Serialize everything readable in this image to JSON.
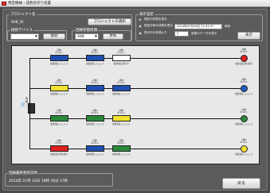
{
  "window": {
    "title": "特定機械・成熟見守り装置"
  },
  "project": {
    "group_label": "プロジェクト名",
    "name": "DAB_50",
    "select_button": "プロジェクトの選択"
  },
  "connection": {
    "group_label": "接続デバイス",
    "device_value": "",
    "connect_button": "接続"
  },
  "interval": {
    "group_label": "回線状態周期",
    "value": "30秒",
    "change_button": "更新"
  },
  "display": {
    "group_label": "表示設定",
    "options": [
      {
        "label": "現在の状態を表示",
        "selected": true
      },
      {
        "label": "指定日時の状態を表示",
        "selected": false
      },
      {
        "label": "表示中の状態より",
        "selected": false
      }
    ],
    "datetime_value": "2014年07月16日 11:31:47",
    "datetime_suffix": "時刻",
    "offset_value": "0",
    "offset_suffix": "前後のデータを表示",
    "show_button": "表示"
  },
  "network": {
    "gateway_label": "親機",
    "rows": [
      {
        "nodes": [
          {
            "head": "子機1\nID:ID:1",
            "foot": "電波強度:ｙｙｙ_0",
            "color": "#1f4fb0"
          },
          {
            "head": "子機2\nID:ID:2",
            "foot": "電波強度:ｙｙｙ_0",
            "color": "#1f4fb0"
          },
          {
            "head": "子機3\nID:ID:3",
            "foot": "電波強度:警告中",
            "color": "#ffffff"
          }
        ],
        "end": {
          "head": "子機4\nID:ID:4",
          "foot": "電波強度:通信異常",
          "color": "#e02020"
        }
      },
      {
        "nodes": [
          {
            "head": "子機1\nID:ID:1",
            "foot": "電波強度:ｙｙｙ_0",
            "color": "#f0e030"
          },
          {
            "head": "子機2\nID:ID:2",
            "foot": "電波強度:ｙｙｙ_0",
            "color": "#1f4fb0"
          },
          {
            "head": "子機3\nID:ID:3",
            "foot": "電波強度:ｙｙｙ_0",
            "color": "#1f4fb0"
          }
        ],
        "end": {
          "head": "子機4\nID:ID:4",
          "foot": "電波強度:ｙｙｙ_0",
          "color": "#2060c0"
        }
      },
      {
        "nodes": [
          {
            "head": "子機1\nID:ID:1",
            "foot": "電波強度:ｙｙｙ_0",
            "color": "#2a8a3a"
          },
          {
            "head": "子機2\nID:ID:2",
            "foot": "電波強度:ｙｙｙ_0",
            "color": "#2a8a3a"
          },
          {
            "head": "子機3\nID:ID:3",
            "foot": "電波強度:ｙｙｙ_0",
            "color": "#f0e030"
          }
        ],
        "end": {
          "head": "子機4\nID:ID:4",
          "foot": "電波強度:ｙｙｙ_0",
          "color": "#2a8a3a"
        }
      },
      {
        "nodes": [
          {
            "head": "子機1\nID:ID:1",
            "foot": "電波強度:通信異常",
            "color": "#e02020"
          },
          {
            "head": "子機2\nID:ID:2",
            "foot": "電波強度:ｙｙｙ_0",
            "color": "#1f4fb0"
          },
          {
            "head": "子機3\nID:ID:3",
            "foot": "電波強度:ｙｙｙ_0",
            "color": "#2a8a3a"
          }
        ],
        "end": {
          "head": "子機4\nID:ID:4",
          "foot": "電波強度:ｙｙｙ_0",
          "color": "#f0e030"
        }
      }
    ]
  },
  "last_update": {
    "group_label": "回線最終更新日時",
    "value": "2014年 07月 16日  19時 39分 17秒"
  },
  "back_button": "戻る"
}
